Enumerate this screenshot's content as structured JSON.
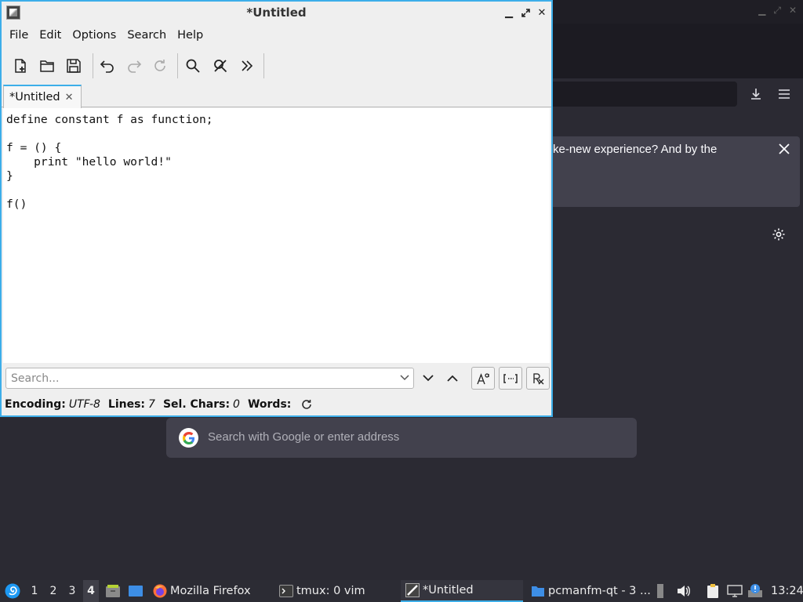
{
  "firefox": {
    "notice_text": "ke-new experience? And by the",
    "search_placeholder": "Search with Google or enter address",
    "icons": [
      "download-icon",
      "hamburger-menu-icon",
      "close-icon",
      "gear-icon",
      "google-icon"
    ]
  },
  "featherpad": {
    "title": "*Untitled",
    "menus": [
      "File",
      "Edit",
      "Options",
      "Search",
      "Help"
    ],
    "toolbar_icons": [
      "new-document-icon",
      "open-folder-icon",
      "save-icon",
      "undo-icon",
      "redo-icon",
      "reload-icon",
      "find-icon",
      "find-replace-icon",
      "more-icon"
    ],
    "tab": {
      "label": "*Untitled"
    },
    "code_lines": [
      "define constant f as function;",
      "",
      "f = () {",
      "    print \"hello world!\"",
      "}",
      "",
      "f()"
    ],
    "search": {
      "placeholder": "Search..."
    },
    "status": {
      "encoding_label": "Encoding:",
      "encoding_value": "UTF-8",
      "lines_label": "Lines:",
      "lines_value": "7",
      "sel_label": "Sel. Chars:",
      "sel_value": "0",
      "words_label": "Words:"
    }
  },
  "taskbar": {
    "desktops": [
      "1",
      "2",
      "3",
      "4"
    ],
    "active_desktop": "4",
    "tasks": [
      {
        "label": "Mozilla Firefox",
        "icon": "firefox-icon"
      },
      {
        "label": "tmux: 0 vim",
        "icon": "terminal-icon"
      },
      {
        "label": "*Untitled",
        "icon": "featherpad-icon"
      },
      {
        "label": "pcmanfm-qt - 3 ...",
        "icon": "folder-icon"
      }
    ],
    "clock": "13:24"
  },
  "colors": {
    "accent": "#3daee9",
    "firefox_bg": "#2b2a33",
    "taskbar_bg": "#2c2c34"
  }
}
